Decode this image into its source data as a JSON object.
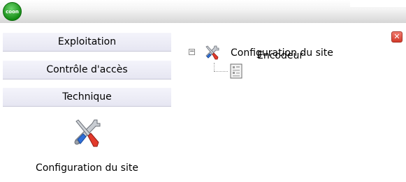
{
  "titlebar": {
    "logo_text": "coon"
  },
  "sidebar": {
    "items": [
      {
        "label": "Exploitation"
      },
      {
        "label": "Contrôle d'accès"
      },
      {
        "label": "Technique"
      }
    ],
    "tool": {
      "label": "Configuration du site",
      "icon": "tools-icon"
    }
  },
  "content": {
    "close_label": "✕",
    "tree": {
      "root": {
        "label": "Configuration du site",
        "expander": "−",
        "icon": "tools-icon"
      },
      "children": [
        {
          "label": "Encodeur",
          "icon": "encoder-icon"
        }
      ]
    }
  }
}
